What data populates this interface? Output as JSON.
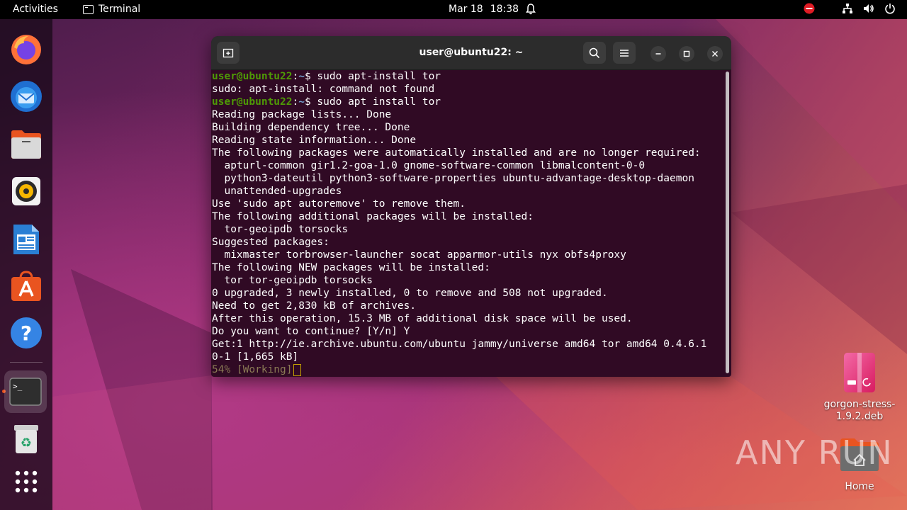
{
  "topbar": {
    "activities": "Activities",
    "app_name": "Terminal",
    "date": "Mar 18",
    "time": "18:38"
  },
  "dock": {
    "items": [
      {
        "name": "firefox-icon"
      },
      {
        "name": "thunderbird-icon"
      },
      {
        "name": "files-icon"
      },
      {
        "name": "rhythmbox-icon"
      },
      {
        "name": "libreoffice-writer-icon"
      },
      {
        "name": "app-center-icon"
      },
      {
        "name": "help-icon"
      },
      {
        "name": "terminal-icon"
      },
      {
        "name": "trash-icon"
      },
      {
        "name": "show-apps-icon"
      }
    ]
  },
  "terminal": {
    "title": "user@ubuntu22: ~",
    "prompt_user": "user@ubuntu22",
    "prompt_path": "~",
    "lines": [
      {
        "kind": "prompt",
        "cmd": " sudo apt-install tor"
      },
      {
        "kind": "out",
        "text": "sudo: apt-install: command not found"
      },
      {
        "kind": "prompt",
        "cmd": " sudo apt install tor"
      },
      {
        "kind": "out",
        "text": "Reading package lists... Done"
      },
      {
        "kind": "out",
        "text": "Building dependency tree... Done"
      },
      {
        "kind": "out",
        "text": "Reading state information... Done"
      },
      {
        "kind": "out",
        "text": "The following packages were automatically installed and are no longer required:"
      },
      {
        "kind": "out",
        "text": "  apturl-common gir1.2-goa-1.0 gnome-software-common libmalcontent-0-0"
      },
      {
        "kind": "out",
        "text": "  python3-dateutil python3-software-properties ubuntu-advantage-desktop-daemon"
      },
      {
        "kind": "out",
        "text": "  unattended-upgrades"
      },
      {
        "kind": "out",
        "text": "Use 'sudo apt autoremove' to remove them."
      },
      {
        "kind": "out",
        "text": "The following additional packages will be installed:"
      },
      {
        "kind": "out",
        "text": "  tor-geoipdb torsocks"
      },
      {
        "kind": "out",
        "text": "Suggested packages:"
      },
      {
        "kind": "out",
        "text": "  mixmaster torbrowser-launcher socat apparmor-utils nyx obfs4proxy"
      },
      {
        "kind": "out",
        "text": "The following NEW packages will be installed:"
      },
      {
        "kind": "out",
        "text": "  tor tor-geoipdb torsocks"
      },
      {
        "kind": "out",
        "text": "0 upgraded, 3 newly installed, 0 to remove and 508 not upgraded."
      },
      {
        "kind": "out",
        "text": "Need to get 2,830 kB of archives."
      },
      {
        "kind": "out",
        "text": "After this operation, 15.3 MB of additional disk space will be used."
      },
      {
        "kind": "out",
        "text": "Do you want to continue? [Y/n] Y"
      },
      {
        "kind": "out",
        "text": "Get:1 http://ie.archive.ubuntu.com/ubuntu jammy/universe amd64 tor amd64 0.4.6.1"
      },
      {
        "kind": "out",
        "text": "0-1 [1,665 kB]"
      },
      {
        "kind": "status",
        "text": "54% [Working]"
      }
    ]
  },
  "desktop": {
    "deb_file": "gorgon-stress-1.9.2.deb",
    "home": "Home"
  },
  "watermark": "ANY RUN"
}
